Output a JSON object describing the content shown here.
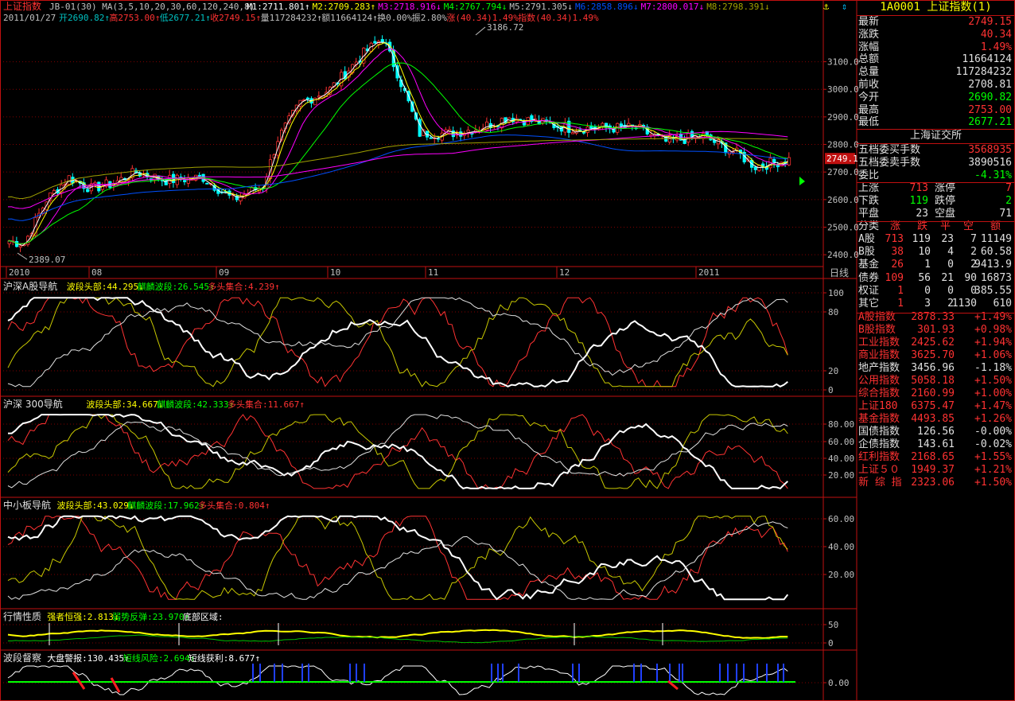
{
  "main": {
    "title": "上证指数",
    "formula": "JB-01(30)  MA(3,5,10,20,30,60,120,240,8)",
    "ma": [
      {
        "text": "M1:2711.801↑",
        "color": "#ffffff"
      },
      {
        "text": "M2:2709.283↑",
        "color": "#ffff00"
      },
      {
        "text": "M3:2718.916↓",
        "color": "#ff00ff"
      },
      {
        "text": "M4:2767.794↓",
        "color": "#00ff00"
      },
      {
        "text": "M5:2791.305↓",
        "color": "#c0c0c0"
      },
      {
        "text": "M6:2858.896↓",
        "color": "#0050ff"
      },
      {
        "text": "M7:2800.017↓",
        "color": "#ff00ff"
      },
      {
        "text": "M8:2798.391↓",
        "color": "#a0a000"
      }
    ],
    "info": [
      {
        "text": "2011/01/27",
        "color": "#c0c0c0"
      },
      {
        "text": "开2690.82↑",
        "color": "#00c0c0"
      },
      {
        "text": "高2753.00↑",
        "color": "#ff3232"
      },
      {
        "text": "低2677.21↑",
        "color": "#00c0c0"
      },
      {
        "text": "收2749.15↑",
        "color": "#ff3232"
      },
      {
        "text": "量117284232↑",
        "color": "#c0c0c0"
      },
      {
        "text": "额11664124↑",
        "color": "#c0c0c0"
      },
      {
        "text": "换0.00%",
        "color": "#c0c0c0"
      },
      {
        "text": "振2.80%",
        "color": "#c0c0c0"
      },
      {
        "text": "涨(40.34)1.49%",
        "color": "#ff3232"
      },
      {
        "text": "指数(40.34)1.49%",
        "color": "#ff3232"
      }
    ],
    "y_ticks": [
      "3100.0",
      "3000.0",
      "2900.0",
      "2800.0",
      "2700.0",
      "2600.0",
      "2500.0",
      "2400.0"
    ],
    "current_price": "2749.1",
    "high_label": "3186.72",
    "low_label": "2389.07",
    "x_labels": [
      "2010",
      "08",
      "09",
      "10",
      "11",
      "12",
      "2011"
    ],
    "period_label": "日线"
  },
  "panels": [
    {
      "title": "沪深A股导航",
      "items": [
        {
          "text": "波段头部:44.295↓",
          "color": "#ffff00"
        },
        {
          "text": "麒麟波段:26.545↑",
          "color": "#00ff00"
        },
        {
          "text": "多头集合:4.239↑",
          "color": "#ff3232"
        }
      ],
      "ticks": [
        "100",
        "80",
        "20",
        "0"
      ]
    },
    {
      "title": "沪深 300导航",
      "items": [
        {
          "text": "波段头部:34.667↓",
          "color": "#ffff00"
        },
        {
          "text": "麒麟波段:42.333↑",
          "color": "#00ff00"
        },
        {
          "text": "多头集合:11.667↑",
          "color": "#ff3232"
        }
      ],
      "ticks": [
        "80.00",
        "60.00",
        "40.00",
        "20.00"
      ]
    },
    {
      "title": "中小板导航",
      "items": [
        {
          "text": "波段头部:43.029↓",
          "color": "#ffff00"
        },
        {
          "text": "麒麟波段:17.962↑",
          "color": "#00ff00"
        },
        {
          "text": "多头集合:0.804↑",
          "color": "#ff3232"
        }
      ],
      "ticks": [
        "60.00",
        "40.00",
        "20.00"
      ]
    },
    {
      "title": "行情性质",
      "items": [
        {
          "text": "强者恒强:2.813↓",
          "color": "#ffff00"
        },
        {
          "text": "弱势反弹:23.970↑",
          "color": "#00ff00"
        },
        {
          "text": "底部区域:",
          "color": "#ffffff"
        }
      ],
      "ticks": [
        "50",
        "0"
      ]
    },
    {
      "title": "波段督察",
      "items": [
        {
          "text": "大盘警报:130.435↑",
          "color": "#ffffff"
        },
        {
          "text": "短线风险:2.694↑",
          "color": "#00ff00"
        },
        {
          "text": "短线获利:8.677↑",
          "color": "#ffffff"
        }
      ],
      "ticks": [
        "0.00"
      ]
    }
  ],
  "sidebar": {
    "code": "1A0001",
    "name": "上证指数(1)",
    "quote": [
      {
        "label": "最新",
        "value": "2749.15",
        "color": "#ff3232"
      },
      {
        "label": "涨跌",
        "value": "40.34",
        "color": "#ff3232"
      },
      {
        "label": "涨幅",
        "value": "1.49%",
        "color": "#ff3232"
      },
      {
        "label": "总额",
        "value": "11664124",
        "color": "#e0e0e0"
      },
      {
        "label": "总量",
        "value": "117284232",
        "color": "#e0e0e0"
      },
      {
        "label": "前收",
        "value": "2708.81",
        "color": "#e0e0e0"
      },
      {
        "label": "今开",
        "value": "2690.82",
        "color": "#00ff00"
      },
      {
        "label": "最高",
        "value": "2753.00",
        "color": "#ff3232"
      },
      {
        "label": "最低",
        "value": "2677.21",
        "color": "#00ff00"
      }
    ],
    "exchange": "上海证交所",
    "orders": [
      {
        "label": "五档委买手数",
        "value": "3568935",
        "color": "#ff3232"
      },
      {
        "label": "五档委卖手数",
        "value": "3890516",
        "color": "#e0e0e0"
      },
      {
        "label": "委比",
        "value": "-4.31%",
        "color": "#00ff00"
      }
    ],
    "breadth": [
      {
        "l1": "上涨",
        "v1": "713",
        "c1": "#ff3232",
        "l2": "涨停",
        "v2": "7",
        "c2": "#ff3232"
      },
      {
        "l1": "下跌",
        "v1": "119",
        "c1": "#00ff00",
        "l2": "跌停",
        "v2": "2",
        "c2": "#00ff00"
      },
      {
        "l1": "平盘",
        "v1": "23",
        "c1": "#e0e0e0",
        "l2": "空盘",
        "v2": "71",
        "c2": "#e0e0e0"
      }
    ],
    "class_header": [
      "分类",
      "涨",
      "跌",
      "平",
      "空",
      "额"
    ],
    "classes": [
      {
        "name": "A股",
        "up": "713",
        "down": "119",
        "flat": "23",
        "halt": "7",
        "amount": "11149"
      },
      {
        "name": "B股",
        "up": "38",
        "down": "10",
        "flat": "4",
        "halt": "2",
        "amount": "60.58"
      },
      {
        "name": "基金",
        "up": "26",
        "down": "1",
        "flat": "0",
        "halt": "2",
        "amount": "9413.9"
      },
      {
        "name": "债券",
        "up": "109",
        "down": "56",
        "flat": "21",
        "halt": "90",
        "amount": "16873"
      },
      {
        "name": "权证",
        "up": "1",
        "down": "0",
        "flat": "0",
        "halt": "0",
        "amount": "385.55"
      },
      {
        "name": "其它",
        "up": "1",
        "down": "3",
        "flat": "2",
        "halt": "1130",
        "amount": "610"
      }
    ],
    "indices": [
      {
        "name": "A股指数",
        "value": "2878.33",
        "change": "+1.49%",
        "color": "#ff3232"
      },
      {
        "name": "B股指数",
        "value": "301.93",
        "change": "+0.98%",
        "color": "#ff3232"
      },
      {
        "name": "工业指数",
        "value": "2425.62",
        "change": "+1.94%",
        "color": "#ff3232"
      },
      {
        "name": "商业指数",
        "value": "3625.70",
        "change": "+1.06%",
        "color": "#ff3232"
      },
      {
        "name": "地产指数",
        "value": "3456.96",
        "change": "-1.18%",
        "color": "#e0e0e0"
      },
      {
        "name": "公用指数",
        "value": "5058.18",
        "change": "+1.50%",
        "color": "#ff3232"
      },
      {
        "name": "综合指数",
        "value": "2160.99",
        "change": "+1.00%",
        "color": "#ff3232"
      },
      {
        "name": "上证180",
        "value": "6375.47",
        "change": "+1.47%",
        "color": "#ff3232"
      },
      {
        "name": "基金指数",
        "value": "4493.85",
        "change": "+1.26%",
        "color": "#ff3232"
      },
      {
        "name": "国债指数",
        "value": "126.56",
        "change": "-0.00%",
        "color": "#e0e0e0"
      },
      {
        "name": "企债指数",
        "value": "143.61",
        "change": "-0.02%",
        "color": "#e0e0e0"
      },
      {
        "name": "红利指数",
        "value": "2168.65",
        "change": "+1.55%",
        "color": "#ff3232"
      },
      {
        "name": "上证５０",
        "value": "1949.37",
        "change": "+1.21%",
        "color": "#ff3232"
      },
      {
        "name": "新 综 指",
        "value": "2323.06",
        "change": "+1.50%",
        "color": "#ff3232"
      }
    ]
  },
  "colors": {
    "up": "#ff3232",
    "down": "#00ffff",
    "grid": "#800000",
    "frame": "#c01010"
  }
}
